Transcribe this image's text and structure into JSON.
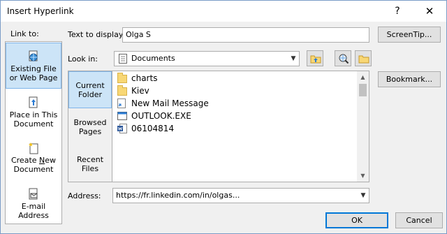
{
  "window": {
    "title": "Insert Hyperlink",
    "help_glyph": "?",
    "close_glyph": "✕"
  },
  "link_to": {
    "label": "Link to:",
    "items": [
      {
        "label_line1": "Existing File",
        "label_line2": "or Web Page",
        "icon": "globe-file-icon",
        "selected": true
      },
      {
        "label_line1": "Place in This",
        "label_line2": "Document",
        "icon": "document-place-icon",
        "selected": false
      },
      {
        "label_line1": "Create New",
        "label_line2": "Document",
        "icon": "new-document-icon",
        "selected": false
      },
      {
        "label_line1": "E-mail",
        "label_line2": "Address",
        "icon": "email-icon",
        "selected": false
      }
    ]
  },
  "text_to_display": {
    "label": "Text to display:",
    "value": "Olga S"
  },
  "screentip_label": "ScreenTip...",
  "look_in": {
    "label": "Look in:",
    "value": "Documents"
  },
  "bookmark_label": "Bookmark...",
  "browse_tabs": [
    {
      "line1": "Current",
      "line2": "Folder",
      "selected": true
    },
    {
      "line1": "Browsed",
      "line2": "Pages",
      "selected": false
    },
    {
      "line1": "Recent",
      "line2": "Files",
      "selected": false
    }
  ],
  "files": [
    {
      "name": "charts",
      "icon": "folder-icon"
    },
    {
      "name": "Kiev",
      "icon": "folder-icon"
    },
    {
      "name": "New Mail Message",
      "icon": "shortcut-icon"
    },
    {
      "name": "OUTLOOK.EXE",
      "icon": "exe-icon"
    },
    {
      "name": "06104814",
      "icon": "word-doc-icon"
    }
  ],
  "address": {
    "label": "Address:",
    "value": "https://fr.linkedin.com/in/olgas..."
  },
  "ok_label": "OK",
  "cancel_label": "Cancel",
  "colors": {
    "selected_bg": "#cce4f7",
    "selected_border": "#7eb4ea",
    "accent": "#0078d7"
  }
}
